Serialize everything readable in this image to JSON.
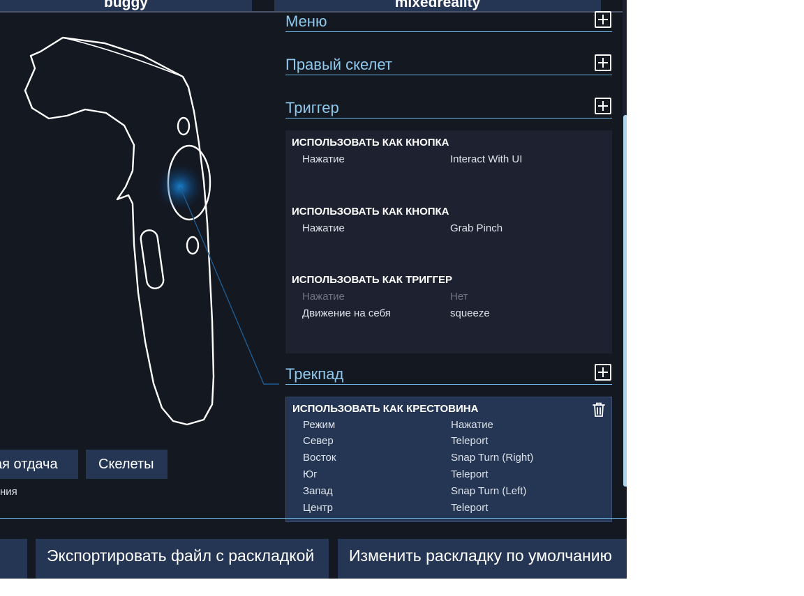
{
  "top_tabs": [
    "buggy",
    "mixedreality"
  ],
  "left_panel": {
    "buttons": [
      "ая отдача",
      "Скелеты"
    ],
    "small_text": "ния"
  },
  "sections": {
    "menu": "Меню",
    "right_skeleton": "Правый скелет",
    "trigger": "Триггер",
    "trackpad": "Трекпад"
  },
  "trigger_bindings": [
    {
      "title": "ИСПОЛЬЗОВАТЬ КАК КНОПКА",
      "rows": [
        {
          "key": "Нажатие",
          "value": "Interact With UI"
        }
      ]
    },
    {
      "title": "ИСПОЛЬЗОВАТЬ КАК КНОПКА",
      "rows": [
        {
          "key": "Нажатие",
          "value": "Grab Pinch"
        }
      ]
    },
    {
      "title": "ИСПОЛЬЗОВАТЬ КАК ТРИГГЕР",
      "rows": [
        {
          "key": "Нажатие",
          "value": "Нет",
          "dim": true
        },
        {
          "key": "Движение на себя",
          "value": "squeeze"
        }
      ]
    }
  ],
  "trackpad_binding": {
    "title": "ИСПОЛЬЗОВАТЬ КАК КРЕСТОВИНА",
    "rows": [
      {
        "key": "Режим",
        "value": "Нажатие"
      },
      {
        "key": "Север",
        "value": "Teleport"
      },
      {
        "key": "Восток",
        "value": "Snap Turn (Right)"
      },
      {
        "key": "Юг",
        "value": "Teleport"
      },
      {
        "key": "Запад",
        "value": "Snap Turn (Left)"
      },
      {
        "key": "Центр",
        "value": "Teleport"
      }
    ]
  },
  "bottom_buttons": [
    "Экспортировать файл с раскладкой",
    "Изменить раскладку по умолчанию"
  ],
  "icons": {
    "plus": "plus-box-icon",
    "trash": "trash-icon"
  },
  "colors": {
    "background": "#141821",
    "accent": "#8fc9ee",
    "button": "#253655",
    "panel": "#1e2130",
    "selected_panel": "#243654"
  }
}
